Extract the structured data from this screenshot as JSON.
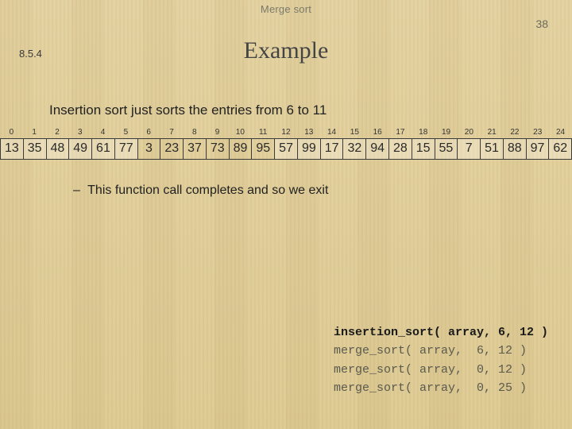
{
  "header": {
    "topic": "Merge sort",
    "page": "38"
  },
  "section": "8.5.4",
  "title": "Example",
  "body": "Insertion sort just sorts the entries from 6 to 11",
  "indices": [
    "0",
    "1",
    "2",
    "3",
    "4",
    "5",
    "6",
    "7",
    "8",
    "9",
    "10",
    "11",
    "12",
    "13",
    "14",
    "15",
    "16",
    "17",
    "18",
    "19",
    "20",
    "21",
    "22",
    "23",
    "24"
  ],
  "array": [
    {
      "v": "13",
      "hl": true
    },
    {
      "v": "35",
      "hl": true
    },
    {
      "v": "48",
      "hl": true
    },
    {
      "v": "49",
      "hl": true
    },
    {
      "v": "61",
      "hl": true
    },
    {
      "v": "77",
      "hl": true
    },
    {
      "v": "3",
      "hl": false
    },
    {
      "v": "23",
      "hl": false
    },
    {
      "v": "37",
      "hl": false
    },
    {
      "v": "73",
      "hl": false
    },
    {
      "v": "89",
      "hl": false
    },
    {
      "v": "95",
      "hl": false
    },
    {
      "v": "57",
      "hl": true
    },
    {
      "v": "99",
      "hl": true
    },
    {
      "v": "17",
      "hl": true
    },
    {
      "v": "32",
      "hl": true
    },
    {
      "v": "94",
      "hl": true
    },
    {
      "v": "28",
      "hl": true
    },
    {
      "v": "15",
      "hl": true
    },
    {
      "v": "55",
      "hl": true
    },
    {
      "v": "7",
      "hl": true
    },
    {
      "v": "51",
      "hl": true
    },
    {
      "v": "88",
      "hl": true
    },
    {
      "v": "97",
      "hl": true
    },
    {
      "v": "62",
      "hl": true
    }
  ],
  "bullet": "This function call completes and so we exit",
  "code": {
    "lines": [
      {
        "t": "insertion_sort( array, 6, 12 )",
        "active": true
      },
      {
        "t": "merge_sort( array,  6, 12 )",
        "active": false
      },
      {
        "t": "merge_sort( array,  0, 12 )",
        "active": false
      },
      {
        "t": "merge_sort( array,  0, 25 )",
        "active": false
      }
    ]
  }
}
